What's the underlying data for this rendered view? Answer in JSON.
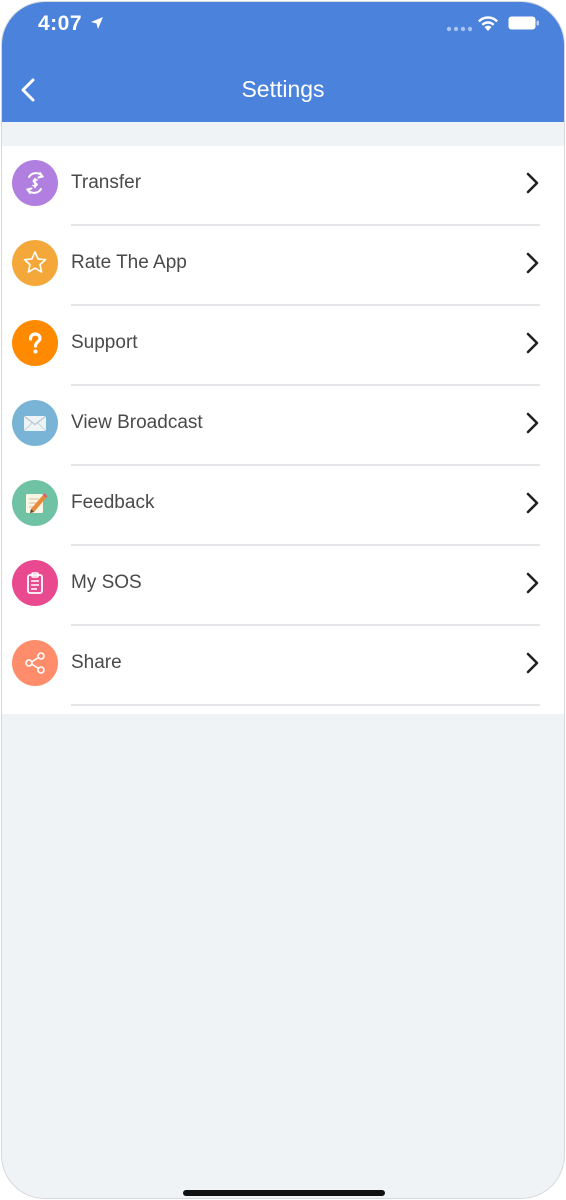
{
  "status_bar": {
    "time": "4:07"
  },
  "nav": {
    "title": "Settings"
  },
  "colors": {
    "header_blue": "#4b82db",
    "transfer": "#b07fe0",
    "rate": "#f4a83a",
    "support": "#ff8a00",
    "broadcast": "#79b4d6",
    "feedback": "#6fc2a4",
    "sos": "#e94a8f",
    "share": "#ff8c6b"
  },
  "menu": {
    "items": [
      {
        "label": "Transfer",
        "icon": "transfer-icon"
      },
      {
        "label": "Rate The App",
        "icon": "star-icon"
      },
      {
        "label": "Support",
        "icon": "question-icon"
      },
      {
        "label": "View Broadcast",
        "icon": "envelope-icon"
      },
      {
        "label": "Feedback",
        "icon": "pencil-note-icon"
      },
      {
        "label": "My SOS",
        "icon": "clipboard-icon"
      },
      {
        "label": "Share",
        "icon": "share-icon"
      }
    ]
  }
}
